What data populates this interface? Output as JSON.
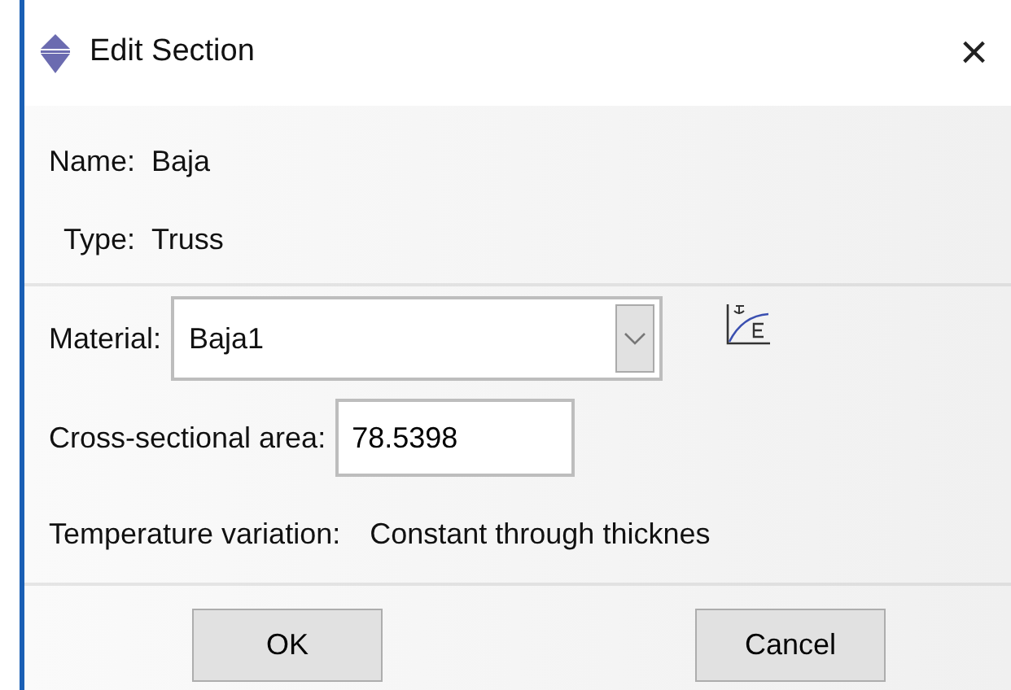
{
  "window": {
    "title": "Edit Section",
    "close": "×"
  },
  "name": {
    "label": "Name:",
    "value": "Baja"
  },
  "type": {
    "label": "Type:",
    "value": "Truss"
  },
  "material": {
    "label": "Material:",
    "value": "Baja1"
  },
  "area": {
    "label": "Cross-sectional area:",
    "value": "78.5398"
  },
  "temperature": {
    "label": "Temperature variation:",
    "value": "Constant through thicknes"
  },
  "buttons": [
    "OK",
    "Cancel"
  ]
}
